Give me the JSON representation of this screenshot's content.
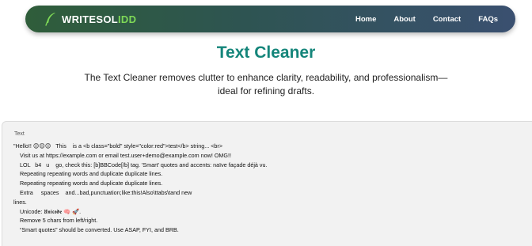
{
  "brand": {
    "name_main": "WRITESOL",
    "name_accent": "IDD",
    "accent_color": "#7ed957"
  },
  "nav": {
    "items": [
      {
        "label": "Home"
      },
      {
        "label": "About"
      },
      {
        "label": "Contact"
      },
      {
        "label": "FAQs"
      }
    ]
  },
  "main": {
    "title": "Text Cleaner",
    "subtitle": "The Text Cleaner removes clutter to enhance clarity, readability, and professionalism—ideal for refining drafts.",
    "title_color": "#14857a"
  },
  "editor": {
    "label": "Text",
    "content": "\"Hello!! 😊😊😊   This    is a <b class=\"bold\" style=\"color:red\">test</b> string... <br>\n    Visit us at https://example.com or email test.user+demo@example.com now! OMG!!\n    LOL   b4   u    go, check this: [b]BBCode[/b] tag. 'Smart' quotes and accents: naïve façade déjà vu.\n    Repeating repeating words and duplicate duplicate lines.\n    Repeating repeating words and duplicate duplicate lines.\n    Extra     spaces    and...bad,punctuation;like:this!Also\\ttabs\\tand new\nlines.\n    Unicode: 𝖀𝖓𝖎𝖈𝖔𝖉𝖊 🧠 🚀.\n    Remove 5 chars from left/right.\n    “Smart quotes” should be converted. Use ASAP, FYI, and BRB."
  }
}
